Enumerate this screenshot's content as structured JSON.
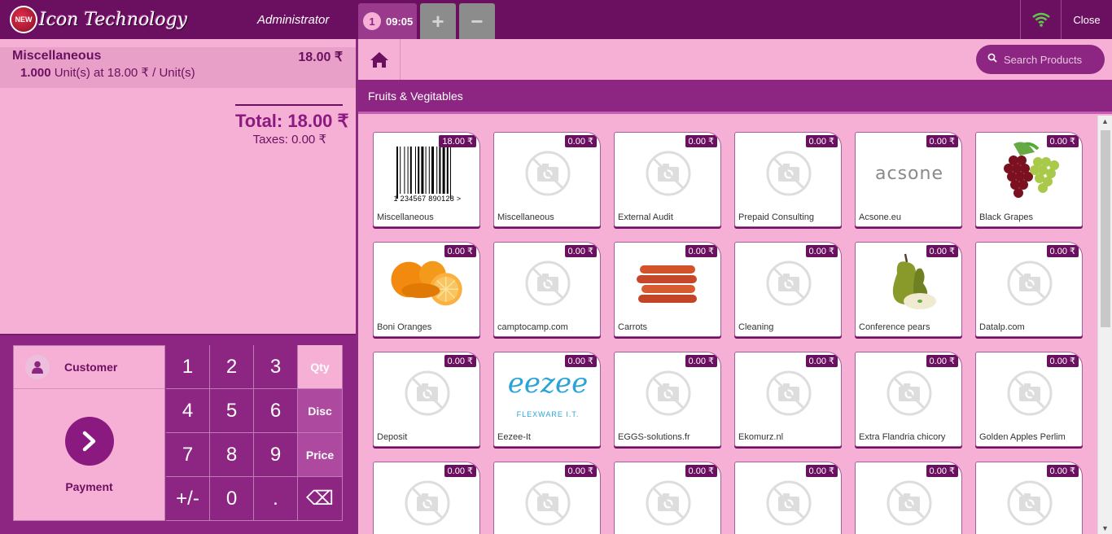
{
  "header": {
    "logo_text": "Icon Technology",
    "logo_badge": "NEW",
    "user": "Administrator",
    "order_number": "1",
    "order_time": "09:05",
    "add_label": "+",
    "remove_label": "−",
    "close_label": "Close"
  },
  "order": {
    "line_name": "Miscellaneous",
    "line_price": "18.00 ₹",
    "line_qty": "1.000",
    "line_detail": "Unit(s) at 18.00 ₹ / Unit(s)",
    "total": "Total: 18.00 ₹",
    "taxes": "Taxes: 0.00 ₹"
  },
  "actions": {
    "customer": "Customer",
    "payment": "Payment"
  },
  "numpad": [
    "1",
    "2",
    "3",
    "Qty",
    "4",
    "5",
    "6",
    "Disc",
    "7",
    "8",
    "9",
    "Price",
    "+/-",
    "0",
    ".",
    "⌫"
  ],
  "search": {
    "placeholder": "Search Products"
  },
  "category": "Fruits & Vegitables",
  "products": [
    {
      "name": "Miscellaneous",
      "price": "18.00 ₹",
      "image": "barcode",
      "barcode_text": "1 234567 890128 >"
    },
    {
      "name": "Miscellaneous",
      "price": "0.00 ₹",
      "image": "placeholder"
    },
    {
      "name": "External Audit",
      "price": "0.00 ₹",
      "image": "placeholder"
    },
    {
      "name": "Prepaid Consulting",
      "price": "0.00 ₹",
      "image": "placeholder"
    },
    {
      "name": "Acsone.eu",
      "price": "0.00 ₹",
      "image": "acsone",
      "logo_text": "acsone"
    },
    {
      "name": "Black Grapes",
      "price": "0.00 ₹",
      "image": "grapes"
    },
    {
      "name": "Boni Oranges",
      "price": "0.00 ₹",
      "image": "oranges"
    },
    {
      "name": "camptocamp.com",
      "price": "0.00 ₹",
      "image": "placeholder"
    },
    {
      "name": "Carrots",
      "price": "0.00 ₹",
      "image": "carrots"
    },
    {
      "name": "Cleaning",
      "price": "0.00 ₹",
      "image": "placeholder"
    },
    {
      "name": "Conference pears",
      "price": "0.00 ₹",
      "image": "pears"
    },
    {
      "name": "Datalp.com",
      "price": "0.00 ₹",
      "image": "placeholder"
    },
    {
      "name": "Deposit",
      "price": "0.00 ₹",
      "image": "placeholder"
    },
    {
      "name": "Eezee-It",
      "price": "0.00 ₹",
      "image": "eezee",
      "logo_text": "eezee",
      "logo_sub": "FLEXWARE I.T."
    },
    {
      "name": "EGGS-solutions.fr",
      "price": "0.00 ₹",
      "image": "placeholder"
    },
    {
      "name": "Ekomurz.nl",
      "price": "0.00 ₹",
      "image": "placeholder"
    },
    {
      "name": "Extra Flandria chicory",
      "price": "0.00 ₹",
      "image": "placeholder"
    },
    {
      "name": "Golden Apples Perlim",
      "price": "0.00 ₹",
      "image": "placeholder"
    },
    {
      "name": "",
      "price": "0.00 ₹",
      "image": "placeholder"
    },
    {
      "name": "",
      "price": "0.00 ₹",
      "image": "placeholder"
    },
    {
      "name": "",
      "price": "0.00 ₹",
      "image": "placeholder"
    },
    {
      "name": "",
      "price": "0.00 ₹",
      "image": "placeholder"
    },
    {
      "name": "",
      "price": "0.00 ₹",
      "image": "placeholder"
    },
    {
      "name": "",
      "price": "0.00 ₹",
      "image": "placeholder"
    }
  ],
  "colors": {
    "primary": "#6b1060",
    "accent": "#8d2682",
    "background": "#f7b0d5"
  }
}
